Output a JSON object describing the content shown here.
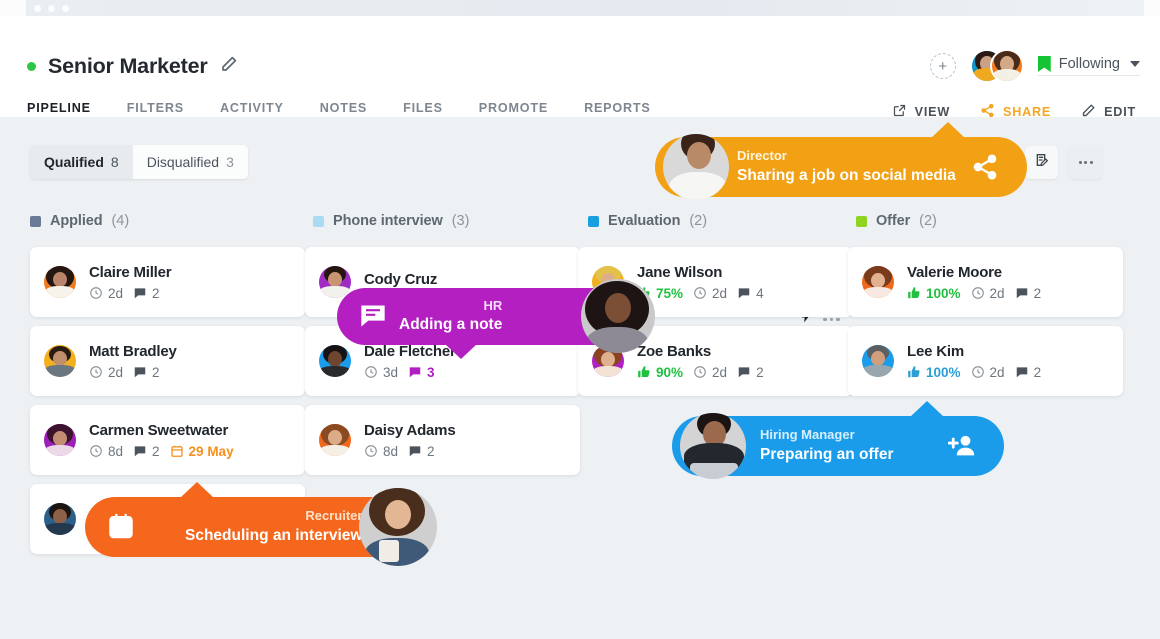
{
  "window": {
    "dots": 3
  },
  "header": {
    "job_title": "Senior Marketer",
    "status_color": "#2ec643",
    "edit_title_icon": "pencil-icon",
    "add_member_label": "+",
    "following_label": "Following",
    "following_icon": "bookmark-icon",
    "tabs": [
      {
        "label": "PIPELINE",
        "active": true
      },
      {
        "label": "FILTERS",
        "active": false
      },
      {
        "label": "ACTIVITY",
        "active": false
      },
      {
        "label": "NOTES",
        "active": false
      },
      {
        "label": "FILES",
        "active": false
      },
      {
        "label": "PROMOTE",
        "active": false
      },
      {
        "label": "REPORTS",
        "active": false
      }
    ],
    "actions": [
      {
        "label": "VIEW",
        "icon": "external-link-icon",
        "color": "#495057"
      },
      {
        "label": "SHARE",
        "icon": "share-icon",
        "color": "#f5a623"
      },
      {
        "label": "EDIT",
        "icon": "pencil-icon",
        "color": "#495057"
      }
    ]
  },
  "board": {
    "filters": {
      "qualified_label": "Qualified",
      "qualified_count": "8",
      "disqualified_label": "Disqualified",
      "disqualified_count": "3"
    },
    "toolbar": {
      "list_edit_icon": "clipboard-edit-icon",
      "more_icon": "more-horizontal-icon"
    },
    "columns": [
      {
        "name": "Applied",
        "count": "(4)",
        "color": "#6b7a99",
        "has_bolt": false,
        "cards": [
          {
            "name": "Claire Miller",
            "days": "2d",
            "comments": "2",
            "avatar_bg": "#f07a1e"
          },
          {
            "name": "Matt Bradley",
            "days": "2d",
            "comments": "2",
            "avatar_bg": "#f2b01e"
          },
          {
            "name": "Carmen Sweetwater",
            "days": "8d",
            "comments": "2",
            "date": "29 May",
            "avatar_bg": "#9c1fb8"
          },
          {
            "name": "",
            "days": "",
            "comments": "",
            "avatar_bg": "#2c5f8a"
          }
        ]
      },
      {
        "name": "Phone interview",
        "count": "(3)",
        "color": "#a9dcf2",
        "has_bolt": true,
        "cards": [
          {
            "name": "Cody Cruz",
            "days": "",
            "comments": "",
            "avatar_bg": "#a02bc4"
          },
          {
            "name": "Dale Fletcher",
            "days": "3d",
            "comments": "3",
            "comments_highlight": "#b01fc2",
            "avatar_bg": "#1b9cea"
          },
          {
            "name": "Daisy Adams",
            "days": "8d",
            "comments": "2",
            "avatar_bg": "#f0681e"
          }
        ]
      },
      {
        "name": "Evaluation",
        "count": "(2)",
        "color": "#189fe0",
        "has_bolt": true,
        "cards": [
          {
            "name": "Jane Wilson",
            "score": "75%",
            "days": "2d",
            "comments": "4",
            "avatar_bg": "#f2b01e"
          },
          {
            "name": "Zoe Banks",
            "score": "90%",
            "days": "2d",
            "comments": "2",
            "avatar_bg": "#b01fc2"
          }
        ]
      },
      {
        "name": "Offer",
        "count": "(2)",
        "color": "#8fd420",
        "has_bolt": false,
        "cards": [
          {
            "name": "Valerie Moore",
            "score": "100%",
            "days": "2d",
            "comments": "2",
            "avatar_bg": "#f0681e"
          },
          {
            "name": "Lee Kim",
            "score": "100%",
            "score_color": "#2b9fd4",
            "days": "2d",
            "comments": "2",
            "avatar_bg": "#1b9cea"
          }
        ]
      }
    ]
  },
  "tooltips": [
    {
      "id": "director",
      "role": "Director",
      "action": "Sharing a job on social media",
      "color": "#f2a115",
      "icon": "share-icon"
    },
    {
      "id": "hr",
      "role": "HR",
      "action": "Adding a note",
      "color": "#b31fc0",
      "icon": "note-icon"
    },
    {
      "id": "hiring-manager",
      "role": "Hiring Manager",
      "action": "Preparing an offer",
      "color": "#1b9cea",
      "icon": "add-person-icon"
    },
    {
      "id": "recruiter",
      "role": "Recruiter",
      "action": "Scheduling an interview",
      "color": "#f4671d",
      "icon": "calendar-add-icon"
    }
  ]
}
